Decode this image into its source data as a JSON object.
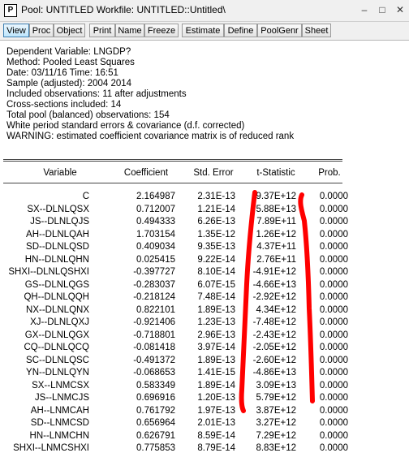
{
  "window": {
    "app_icon": "P",
    "title": "Pool: UNTITLED    Workfile: UNTITLED::Untitled\\",
    "buttons": {
      "minimize": "–",
      "maximize": "□",
      "close": "✕"
    }
  },
  "toolbar": [
    "View",
    "Proc",
    "Object",
    "Print",
    "Name",
    "Freeze",
    "Estimate",
    "Define",
    "PoolGenr",
    "Sheet"
  ],
  "header_lines": [
    "Dependent Variable: LNGDP?",
    "Method: Pooled Least Squares",
    "Date: 03/11/16   Time: 16:51",
    "Sample (adjusted): 2004 2014",
    "Included observations: 11 after adjustments",
    "Cross-sections included: 14",
    "Total pool (balanced) observations: 154",
    "White period standard errors & covariance (d.f. corrected)",
    "WARNING: estimated coefficient covariance matrix is of reduced rank"
  ],
  "table": {
    "columns": [
      "Variable",
      "Coefficient",
      "Std. Error",
      "t-Statistic",
      "Prob."
    ],
    "rows": [
      [
        "C",
        "2.164987",
        "2.31E-13",
        "9.37E+12",
        "0.0000"
      ],
      [
        "SX--DLNLQSX",
        "0.712007",
        "1.21E-14",
        "5.88E+13",
        "0.0000"
      ],
      [
        "JS--DLNLQJS",
        "0.494333",
        "6.26E-13",
        "7.89E+11",
        "0.0000"
      ],
      [
        "AH--DLNLQAH",
        "1.703154",
        "1.35E-12",
        "1.26E+12",
        "0.0000"
      ],
      [
        "SD--DLNLQSD",
        "0.409034",
        "9.35E-13",
        "4.37E+11",
        "0.0000"
      ],
      [
        "HN--DLNLQHN",
        "0.025415",
        "9.22E-14",
        "2.76E+11",
        "0.0000"
      ],
      [
        "SHXI--DLNLQSHXI",
        "-0.397727",
        "8.10E-14",
        "-4.91E+12",
        "0.0000"
      ],
      [
        "GS--DLNLQGS",
        "-0.283037",
        "6.07E-15",
        "-4.66E+13",
        "0.0000"
      ],
      [
        "QH--DLNLQQH",
        "-0.218124",
        "7.48E-14",
        "-2.92E+12",
        "0.0000"
      ],
      [
        "NX--DLNLQNX",
        "0.822101",
        "1.89E-13",
        "4.34E+12",
        "0.0000"
      ],
      [
        "XJ--DLNLQXJ",
        "-0.921406",
        "1.23E-13",
        "-7.48E+12",
        "0.0000"
      ],
      [
        "GX--DLNLQGX",
        "-0.718801",
        "2.96E-13",
        "-2.43E+12",
        "0.0000"
      ],
      [
        "CQ--DLNLQCQ",
        "-0.081418",
        "3.97E-14",
        "-2.05E+12",
        "0.0000"
      ],
      [
        "SC--DLNLQSC",
        "-0.491372",
        "1.89E-13",
        "-2.60E+12",
        "0.0000"
      ],
      [
        "YN--DLNLQYN",
        "-0.068653",
        "1.41E-15",
        "-4.86E+13",
        "0.0000"
      ],
      [
        "SX--LNMCSX",
        "0.583349",
        "1.89E-14",
        "3.09E+13",
        "0.0000"
      ],
      [
        "JS--LNMCJS",
        "0.696916",
        "1.20E-13",
        "5.79E+12",
        "0.0000"
      ],
      [
        "AH--LNMCAH",
        "0.761792",
        "1.97E-13",
        "3.87E+12",
        "0.0000"
      ],
      [
        "SD--LNMCSD",
        "0.656964",
        "2.01E-13",
        "3.27E+12",
        "0.0000"
      ],
      [
        "HN--LNMCHN",
        "0.626791",
        "8.59E-14",
        "7.29E+12",
        "0.0000"
      ],
      [
        "SHXI--LNMCSHXI",
        "0.775853",
        "8.79E-14",
        "8.83E+12",
        "0.0000"
      ]
    ]
  },
  "annotation_color": "#ff0000"
}
